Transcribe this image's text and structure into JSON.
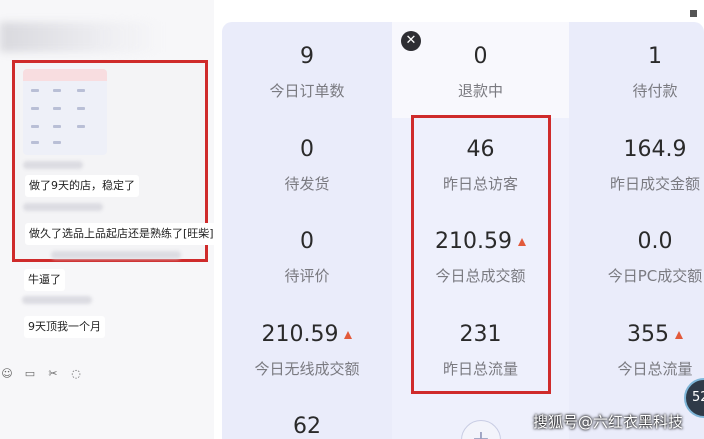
{
  "chat": {
    "messages": [
      {
        "text": "做了9天的店，稳定了"
      },
      {
        "text": "做久了选品上品起店还是熟练了[旺柴]"
      },
      {
        "text": "牛逼了"
      },
      {
        "text": "9天顶我一个月"
      }
    ],
    "toolbar_icons": [
      "emoji-icon",
      "folder-icon",
      "scissors-icon",
      "chat-bubble-icon"
    ]
  },
  "stats": {
    "today_orders": {
      "value": "9",
      "label": "今日订单数"
    },
    "refunding": {
      "value": "0",
      "label": "退款中"
    },
    "pending_payment": {
      "value": "1",
      "label": "待付款"
    },
    "pending_shipment": {
      "value": "0",
      "label": "待发货"
    },
    "yesterday_visitors": {
      "value": "46",
      "label": "昨日总访客"
    },
    "yesterday_gmv": {
      "value": "164.9",
      "label": "昨日成交金额"
    },
    "pending_review": {
      "value": "0",
      "label": "待评价"
    },
    "today_total_gmv": {
      "value": "210.59",
      "label": "今日总成交额"
    },
    "today_pc_gmv": {
      "value": "0.0",
      "label": "今日PC成交额"
    },
    "today_wireless_gmv": {
      "value": "210.59",
      "label": "今日无线成交额"
    },
    "yesterday_traffic": {
      "value": "231",
      "label": "昨日总流量"
    },
    "today_traffic": {
      "value": "355",
      "label": "今日总流量"
    },
    "extra": {
      "value": "62"
    }
  },
  "controls": {
    "close_glyph": "✕",
    "plus_glyph": "+",
    "badge_text": "52"
  },
  "watermark": "搜狐号@六红衣黑科技",
  "colors": {
    "highlight": "#cf2b2b",
    "trend_up": "#e25a3b",
    "panel": "#eaecfa"
  }
}
